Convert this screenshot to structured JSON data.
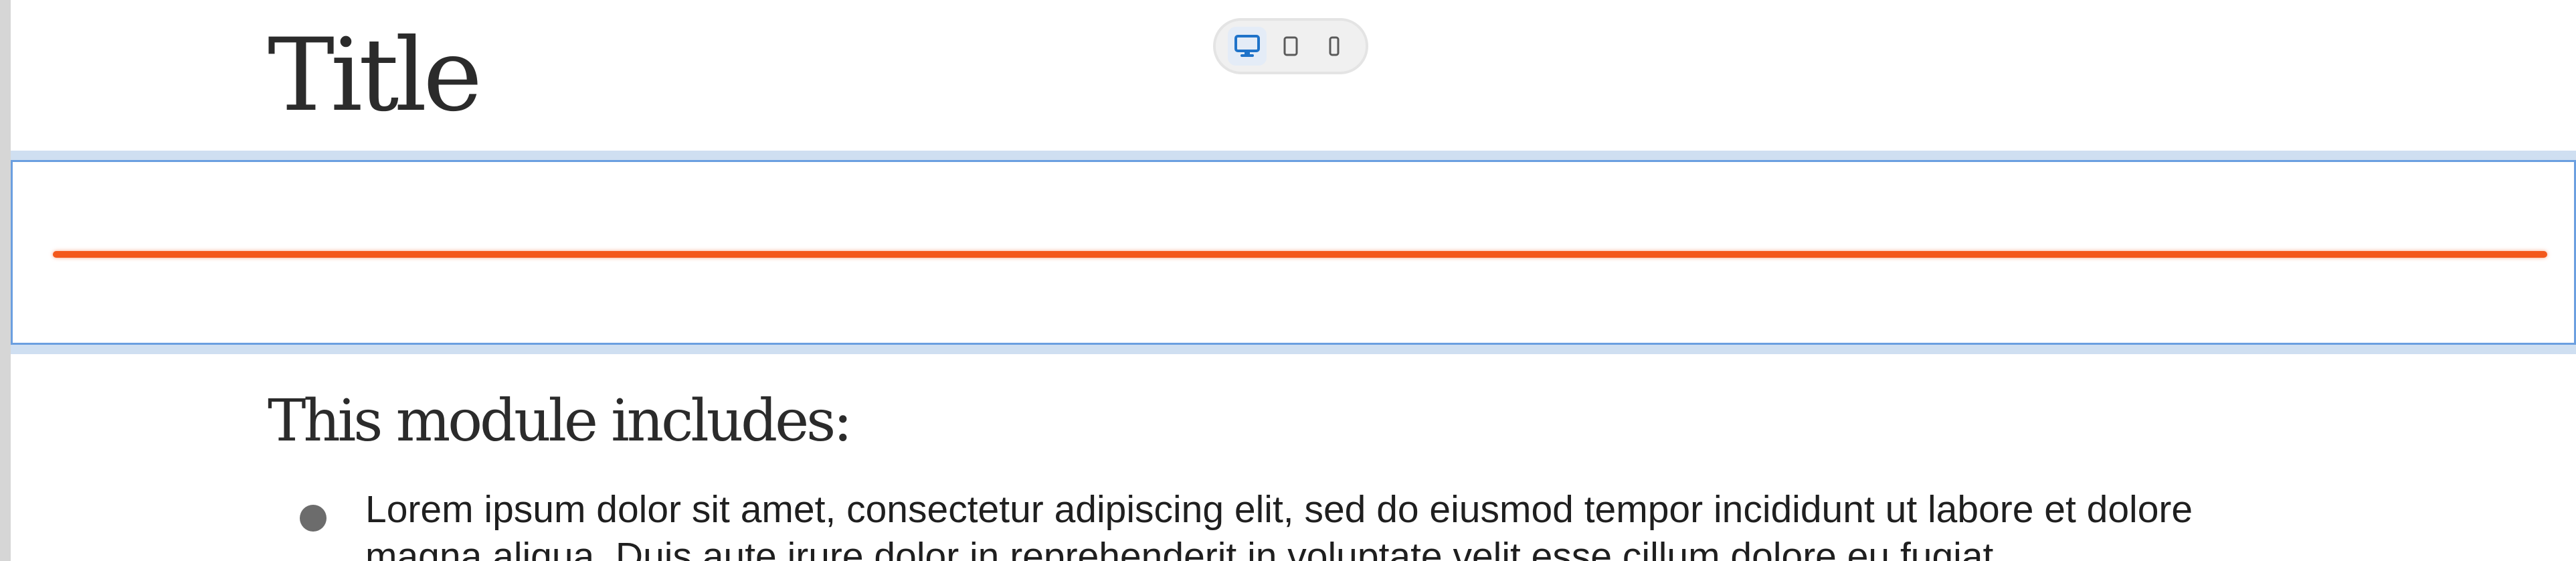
{
  "page": {
    "title": "Title",
    "section_heading": "This module includes:",
    "bullets": [
      "Lorem ipsum dolor sit amet, consectetur adipiscing elit, sed do eiusmod tempor incididunt ut labore et dolore magna aliqua. Duis aute irure dolor in reprehenderit in voluptate velit esse cillum dolore eu fugiat"
    ]
  },
  "device_toggle": {
    "selected": "desktop",
    "options": [
      "desktop-icon",
      "tablet-icon",
      "mobile-icon"
    ]
  },
  "colors": {
    "divider": "#f3581b",
    "selection_border": "#6b9fe0",
    "selection_fill": "#cfdff1",
    "active_icon": "#1f73c9",
    "inactive_icon": "#5a5a5a",
    "text": "#2b2b2b"
  }
}
